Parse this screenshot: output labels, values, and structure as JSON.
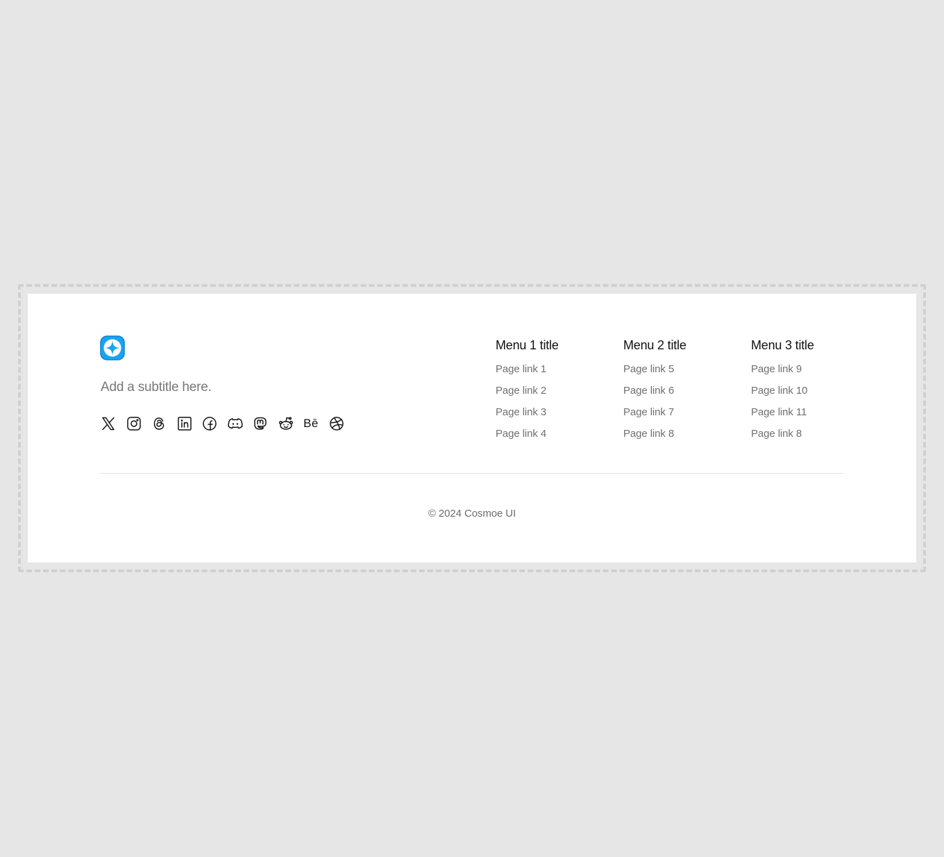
{
  "brand": {
    "logo_icon": "sparkle-star-icon",
    "logo_color": "#1aa3f0",
    "subtitle": "Add a subtitle here."
  },
  "socials": [
    {
      "name": "x-icon"
    },
    {
      "name": "instagram-icon"
    },
    {
      "name": "threads-icon"
    },
    {
      "name": "linkedin-icon"
    },
    {
      "name": "facebook-icon"
    },
    {
      "name": "discord-icon"
    },
    {
      "name": "mastodon-icon"
    },
    {
      "name": "reddit-icon"
    },
    {
      "name": "behance-icon",
      "label": "Bē"
    },
    {
      "name": "dribbble-icon"
    }
  ],
  "menus": [
    {
      "title": "Menu 1 title",
      "links": [
        "Page link 1",
        "Page link 2",
        "Page link 3",
        "Page link 4"
      ]
    },
    {
      "title": "Menu 2 title",
      "links": [
        "Page link 5",
        "Page link 6",
        "Page link 7",
        "Page link 8"
      ]
    },
    {
      "title": "Menu 3 title",
      "links": [
        "Page link 9",
        "Page link 10",
        "Page link 11",
        "Page link 8"
      ]
    }
  ],
  "copyright": "© 2024 Cosmoe UI"
}
